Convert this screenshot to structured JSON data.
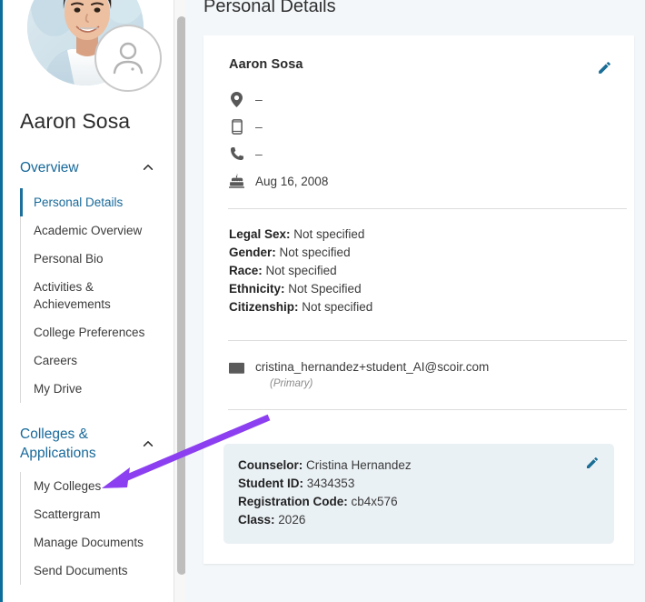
{
  "sidebar": {
    "student_name": "Aaron Sosa",
    "avatar_icon": "person-avatar-icon",
    "groups": [
      {
        "title": "Overview",
        "chevron": "chevron-up-icon",
        "expanded": true,
        "items": [
          {
            "label": "Personal Details",
            "active": true
          },
          {
            "label": "Academic Overview",
            "active": false
          },
          {
            "label": "Personal Bio",
            "active": false
          },
          {
            "label": "Activities & Achievements",
            "active": false
          },
          {
            "label": "College Preferences",
            "active": false
          },
          {
            "label": "Careers",
            "active": false
          },
          {
            "label": "My Drive",
            "active": false
          }
        ]
      },
      {
        "title": "Colleges & Applications",
        "chevron": "chevron-up-icon",
        "expanded": true,
        "items": [
          {
            "label": "My Colleges",
            "active": false
          },
          {
            "label": "Scattergram",
            "active": false
          },
          {
            "label": "Manage Documents",
            "active": false
          },
          {
            "label": "Send Documents",
            "active": false
          }
        ]
      }
    ]
  },
  "main": {
    "page_title": "Personal Details",
    "card": {
      "name": "Aaron Sosa",
      "edit_icon": "pencil-edit-icon",
      "contacts": [
        {
          "icon": "location-pin-icon",
          "value": "–"
        },
        {
          "icon": "mobile-phone-icon",
          "value": "–"
        },
        {
          "icon": "phone-handset-icon",
          "value": "–"
        },
        {
          "icon": "birthday-cake-icon",
          "value": "Aug 16, 2008"
        }
      ],
      "demographics": [
        {
          "label": "Legal Sex:",
          "value": "Not specified"
        },
        {
          "label": "Gender:",
          "value": "Not specified"
        },
        {
          "label": "Race:",
          "value": "Not specified"
        },
        {
          "label": "Ethnicity:",
          "value": "Not Specified"
        },
        {
          "label": "Citizenship:",
          "value": "Not specified"
        }
      ],
      "email": {
        "icon": "envelope-icon",
        "address": "cristina_hernandez+student_AI@scoir.com",
        "note": "(Primary)"
      },
      "counselor_box": {
        "edit_icon": "pencil-edit-icon",
        "rows": [
          {
            "label": "Counselor:",
            "value": "Cristina Hernandez"
          },
          {
            "label": "Student ID:",
            "value": "3434353"
          },
          {
            "label": "Registration Code:",
            "value": "cb4x576"
          },
          {
            "label": "Class:",
            "value": "2026"
          }
        ]
      }
    }
  },
  "annotation": {
    "arrow_icon": "purple-arrow-annotation",
    "color": "#8b3ff0",
    "points_to": "My Colleges"
  },
  "colors": {
    "accent_blue": "#17699a",
    "left_rail": "#0d6d9b",
    "page_bg": "#f3f7fa",
    "card_bg": "#ffffff",
    "counselor_bg": "#eaf1f5",
    "annotation_purple": "#8b3ff0"
  }
}
